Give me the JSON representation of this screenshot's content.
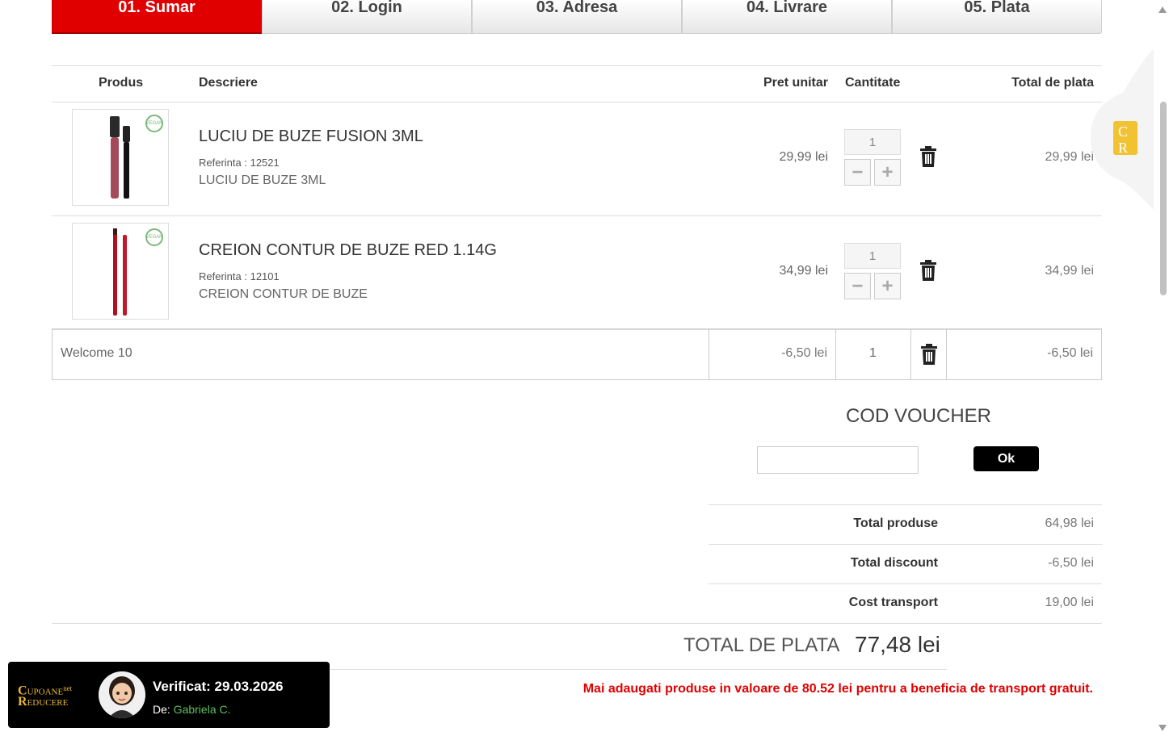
{
  "steps": [
    {
      "label": "01. Sumar",
      "active": true
    },
    {
      "label": "02. Login",
      "active": false
    },
    {
      "label": "03. Adresa",
      "active": false
    },
    {
      "label": "04. Livrare",
      "active": false
    },
    {
      "label": "05. Plata",
      "active": false
    }
  ],
  "table": {
    "headers": {
      "product": "Produs",
      "description": "Descriere",
      "unit_price": "Pret unitar",
      "quantity": "Cantitate",
      "total": "Total de plata"
    },
    "rows": [
      {
        "title": "LUCIU DE BUZE FUSION 3ML",
        "ref": "Referinta : 12521",
        "desc": "LUCIU DE BUZE 3ML",
        "price": "29,99 lei",
        "qty": "1",
        "total": "29,99 lei",
        "badge": "VEGAN"
      },
      {
        "title": "CREION CONTUR DE BUZE RED 1.14G",
        "ref": "Referinta : 12101",
        "desc": "CREION CONTUR DE BUZE",
        "price": "34,99 lei",
        "qty": "1",
        "total": "34,99 lei",
        "badge": "VEGAN"
      }
    ],
    "discount": {
      "name": "Welcome 10",
      "price": "-6,50 lei",
      "qty": "1",
      "total": "-6,50 lei"
    }
  },
  "voucher": {
    "title": "COD VOUCHER",
    "input_value": "",
    "button_label": "Ok"
  },
  "summary": {
    "products_label": "Total produse",
    "products_value": "64,98 lei",
    "discount_label": "Total discount",
    "discount_value": "-6,50 lei",
    "transport_label": "Cost transport",
    "transport_value": "19,00 lei",
    "grand_label": "TOTAL DE PLATA",
    "grand_value": "77,48 lei"
  },
  "transport_message": "Mai adaugati produse in valoare de 80.52 lei pentru a beneficia de transport gratuit.",
  "verified_popup": {
    "logo_line1_big": "C",
    "logo_line1": "UPOANE",
    "logo_net": "net",
    "logo_line2_big": "R",
    "logo_line2": "EDUCERE",
    "title": "Verificat: 29.03.2026",
    "by_label": "De:",
    "by_name": "Gabriela C."
  },
  "side_widget": {
    "letters": "C R"
  },
  "colors": {
    "accent": "#e10000",
    "button": "#000000",
    "name_green": "#5fbf5f"
  }
}
